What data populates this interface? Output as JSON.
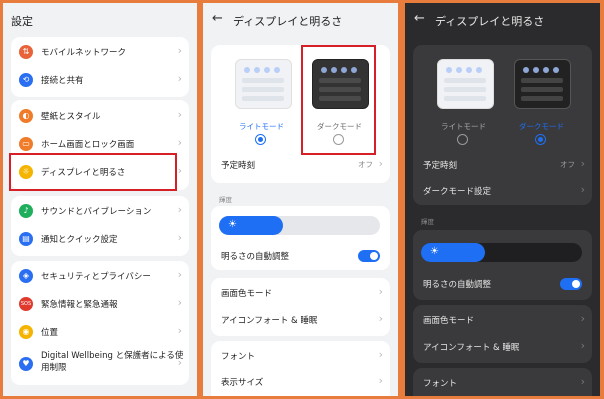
{
  "panel1": {
    "title": "設定",
    "group1": [
      {
        "label": "モバイルネットワーク",
        "icon": "mobile-network-icon",
        "glyph": "⇅",
        "color": "#e8633a"
      },
      {
        "label": "接続と共有",
        "icon": "link-icon",
        "glyph": "⟲",
        "color": "#2a6ff1"
      }
    ],
    "group2": [
      {
        "label": "壁紙とスタイル",
        "icon": "palette-icon",
        "glyph": "◐",
        "color": "#f07c2a"
      },
      {
        "label": "ホーム画面とロック画面",
        "icon": "home-screen-icon",
        "glyph": "▭",
        "color": "#f07c2a"
      },
      {
        "label": "ディスプレイと明るさ",
        "icon": "brightness-icon",
        "glyph": "☼",
        "color": "#f5b400"
      }
    ],
    "group3": [
      {
        "label": "サウンドとバイブレーション",
        "icon": "bell-icon",
        "glyph": "♪",
        "color": "#1fae5b"
      },
      {
        "label": "通知とクイック設定",
        "icon": "notification-icon",
        "glyph": "▤",
        "color": "#2a6ff1"
      }
    ],
    "group4": [
      {
        "label": "セキュリティとプライバシー",
        "icon": "shield-icon",
        "glyph": "◈",
        "color": "#2a6ff1"
      },
      {
        "label": "緊急情報と緊急通報",
        "icon": "sos-icon",
        "glyph": "SOS",
        "color": "#e03a2f"
      },
      {
        "label": "位置",
        "icon": "location-icon",
        "glyph": "◉",
        "color": "#f5b400"
      },
      {
        "label": "Digital Wellbeing と保護者による使用制限",
        "icon": "wellbeing-icon",
        "glyph": "♥",
        "color": "#2a6ff1"
      }
    ]
  },
  "display": {
    "title": "ディスプレイと明るさ",
    "light_mode": "ライトモード",
    "dark_mode": "ダークモード",
    "schedule": "予定時刻",
    "schedule_value": "オフ",
    "dark_settings": "ダークモード設定",
    "brightness_section": "輝度",
    "auto_brightness": "明るさの自動調整",
    "color_mode": "画面色モード",
    "eye_comfort": "アイコンフォート & 睡眠",
    "font": "フォント",
    "display_size": "表示サイズ",
    "brightness_level": 0.4
  },
  "colors": {
    "accent": "#1f6ff4",
    "highlight": "#d61f26",
    "frame": "#e87c3d"
  }
}
